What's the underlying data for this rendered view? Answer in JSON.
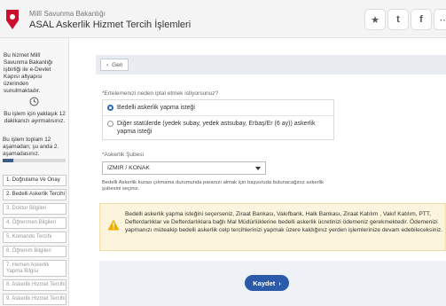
{
  "header": {
    "org_name": "Millî Savunma Bakanlığı",
    "app_title": "ASAL Askerlik Hizmet Tercih İşlemleri",
    "buttons": [
      {
        "icon": "star-icon",
        "glyph": "★"
      },
      {
        "icon": "twitter-icon",
        "glyph": "t"
      },
      {
        "icon": "facebook-icon",
        "glyph": "f"
      },
      {
        "icon": "share-icon",
        "glyph": "⋯"
      }
    ]
  },
  "sidebar": {
    "intro": "Bu hizmet Millî Savunma Bakanlığı işbirliği ile e-Devlet Kapısı altyapısı üzerinden sunulmaktadır.",
    "time_note": "Bu işlem için yaklaşık 12 dakikanızı ayırmalısınız.",
    "step_note": "Bu işlem toplam 12 aşamadan; şu anda 2. aşamadasınız.",
    "progress": 0.17,
    "steps": [
      "1. Doğrulama Ve Onay",
      "2. Bedelli Askerlik Tercihi",
      "3. Doktor Bilgileri",
      "4. Öğrenmen Bilgileri",
      "5. Komando Tercihi",
      "6. Öğrenim Bilgileri",
      "7. Hemen Askerlik Yapma Bilgisi",
      "8. Askerlik Hizmet Tercihi",
      "9. Askerlik Hizmet Tercihi"
    ]
  },
  "topbar": {
    "back_label": "Geri"
  },
  "form": {
    "question": "*Ertelemenizi neden iptal etmek istiyorsunuz?",
    "options": [
      {
        "label": "Bedelli askerlik yapma isteği",
        "selected": true
      },
      {
        "label": "Diğer statülerde (yedek subay, yedek astsubay, Erbaş/Er (6 ay)) askerlik yapma isteği",
        "selected": false
      }
    ],
    "sube_label": "*Askerlik Şubesi",
    "sube_value": "IZMIR / KONAK",
    "note": "Bedelli Askerlik kurası çıkmama durumunda paranızı almak için başvuruda bulunacağınız askerlik şubesini seçiniz."
  },
  "warning": {
    "text": "Bedelli askerlik yapma isteğini seçerseniz, Ziraat Bankası, Vakıfbank, Halk Bankası, Ziraat Katılım , Vakıf Katılım, PTT, Defterdarlıklar ve Defterdarlıklara bağlı Mal Müdürlüklerine bedelli askerlik ücretinizi ödemeniz gerekmektedir. Ödemenizi yapmanızı müteakip bedelli askerlik celp tercihlerinizi yapmak üzere kaldığınız yerden işlemlerinize devam edebileceksiniz."
  },
  "actions": {
    "save_label": "Kaydet"
  },
  "colors": {
    "accent": "#2a5aa8",
    "warning_bg": "#fcf4dc",
    "warning_icon": "#f0ad00"
  }
}
